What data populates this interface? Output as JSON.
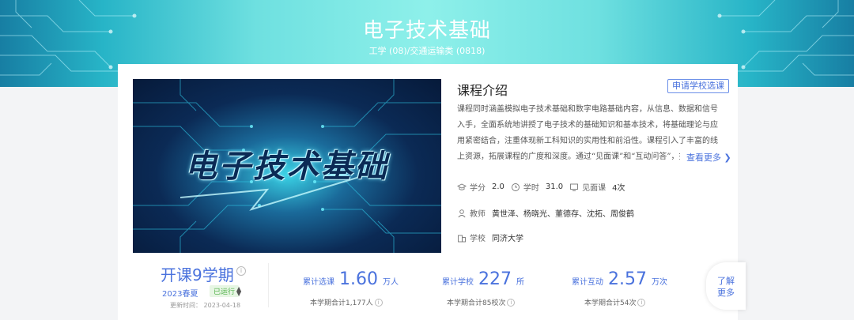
{
  "banner": {
    "title": "电子技术基础",
    "subtitle": "工学 (08)/交通运输类 (0818)"
  },
  "cover": {
    "title": "电子技术基础"
  },
  "intro": {
    "heading": "课程介绍",
    "apply_button": "申请学校选课",
    "description": "课程同时涵盖模拟电子技术基础和数字电路基础内容，从信息、数据和信号入手，全面系统地讲授了电子技术的基础知识和基本技术，将基础理论与应用紧密结合，注重体现新工科知识的实用性和前沿性。课程引入了丰富的线上资源，拓展课程的广度和深度。通过“见面课”和“互动问答”，挖掘知识点蕴含的",
    "more_link": "查看更多 ❯"
  },
  "meta": {
    "credit_label": "学分",
    "credit_value": "2.0",
    "hours_label": "学时",
    "hours_value": "31.0",
    "meeting_label": "见面课",
    "meeting_value": "4次",
    "teacher_label": "教师",
    "teachers": "黄世泽、杨晓光、董德存、沈拓、周俊鹤",
    "school_label": "学校",
    "school": "同济大学"
  },
  "term": {
    "title": "开课9学期",
    "info": "i",
    "season": "2023春夏",
    "status": "已运行",
    "sort": "▲▼",
    "update_label": "更新时间：",
    "update_date": "2023-04-18"
  },
  "stats": [
    {
      "label": "累计选课",
      "value": "1.60",
      "unit": "万人",
      "sub": "本学期合计1,177人",
      "info": "i"
    },
    {
      "label": "累计学校",
      "value": "227",
      "unit": "所",
      "sub": "本学期合计85校次",
      "info": "i"
    },
    {
      "label": "累计互动",
      "value": "2.57",
      "unit": "万次",
      "sub": "本学期合计54次",
      "info": "i"
    }
  ],
  "learn_more": "了解\n更多"
}
